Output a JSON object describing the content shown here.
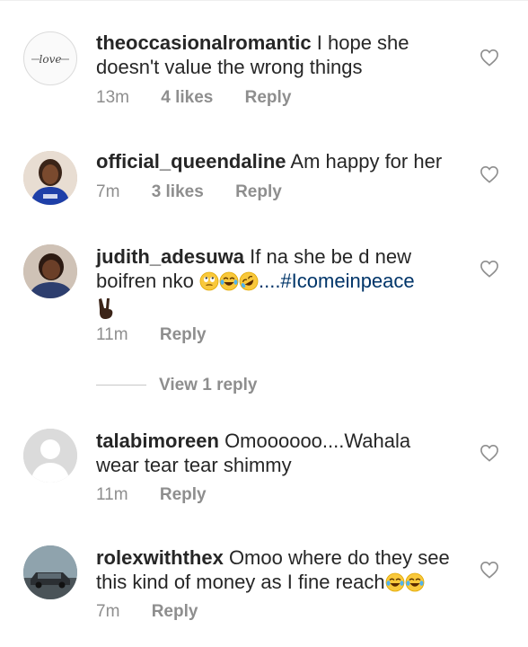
{
  "comments": [
    {
      "username": "theoccasionalromantic",
      "text": "I hope she doesn't value the wrong things",
      "time": "13m",
      "likes": "4 likes",
      "reply": "Reply",
      "avatar_text": "love"
    },
    {
      "username": "official_queendaline",
      "text": "Am happy for her",
      "time": "7m",
      "likes": "3 likes",
      "reply": "Reply"
    },
    {
      "username": "judith_adesuwa",
      "text": "If na she be d new boifren nko",
      "hashtag_text": "....#Icomeinpeace",
      "time": "11m",
      "reply": "Reply"
    },
    {
      "username": "talabimoreen",
      "text": "Omoooooo....Wahala wear tear tear shimmy",
      "time": "11m",
      "reply": "Reply"
    },
    {
      "username": "rolexwiththex",
      "text": "Omoo where do they see this kind of money as I fine reach",
      "time": "7m",
      "reply": "Reply"
    }
  ],
  "view_replies": "View 1 reply",
  "icons": {
    "heart": "heart-outline-icon",
    "emoji_eyeroll": "face-with-rolling-eyes",
    "emoji_laugh": "face-with-tears-of-joy",
    "emoji_rofl": "rolling-on-floor-laughing",
    "emoji_peace": "victory-hand-dark-skin"
  },
  "colors": {
    "text": "#262626",
    "muted": "#8e8e8e",
    "hashtag": "#003569"
  }
}
